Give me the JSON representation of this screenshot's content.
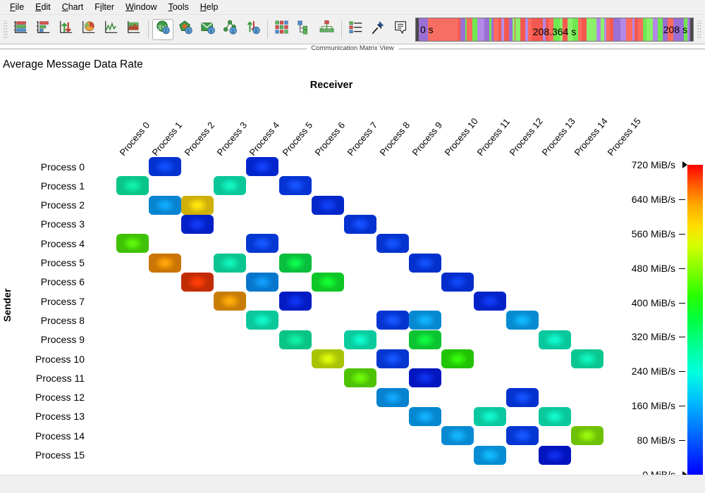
{
  "menubar": {
    "items": [
      {
        "label": "File",
        "accel": "F"
      },
      {
        "label": "Edit",
        "accel": "E"
      },
      {
        "label": "Chart",
        "accel": "C"
      },
      {
        "label": "Filter",
        "accel": "i"
      },
      {
        "label": "Window",
        "accel": "W"
      },
      {
        "label": "Tools",
        "accel": "T"
      },
      {
        "label": "Help",
        "accel": "H"
      }
    ]
  },
  "toolbar": {
    "groups": [
      {
        "buttons": [
          {
            "icon": "bar-chart-horizontal-icon",
            "label": "Bar Chart",
            "selected": false
          },
          {
            "icon": "stacked-chart-icon",
            "label": "Stacked Chart",
            "selected": false
          },
          {
            "icon": "up-down-arrows-icon",
            "label": "Compare Values",
            "selected": false
          },
          {
            "icon": "pie-chart-icon",
            "label": "Pie Chart",
            "selected": false
          },
          {
            "icon": "line-chart-icon",
            "label": "Line Chart",
            "selected": false
          },
          {
            "icon": "area-chart-icon",
            "label": "Area Chart",
            "selected": false
          }
        ]
      },
      {
        "buttons": [
          {
            "icon": "function-sigma-icon",
            "label": "Function Profile",
            "selected": true
          },
          {
            "icon": "pentagon-sigma-icon",
            "label": "Process Profile",
            "selected": false
          },
          {
            "icon": "message-envelope-icon",
            "label": "Message Profile",
            "selected": false
          },
          {
            "icon": "collective-sigma-icon",
            "label": "Collective Operations Profile",
            "selected": false
          },
          {
            "icon": "io-arrows-sigma-icon",
            "label": "I/O Profile",
            "selected": false
          }
        ]
      },
      {
        "buttons": [
          {
            "icon": "matrix-grid-icon",
            "label": "Communication Matrix",
            "selected": false
          },
          {
            "icon": "tree-hierarchy-icon",
            "label": "Call Tree",
            "selected": false
          },
          {
            "icon": "org-tree-icon",
            "label": "Process Tree",
            "selected": false
          }
        ]
      },
      {
        "buttons": [
          {
            "icon": "legend-list-icon",
            "label": "Legend",
            "selected": false
          },
          {
            "icon": "pin-icon",
            "label": "Pin View",
            "selected": false
          },
          {
            "icon": "note-icon",
            "label": "Notes",
            "selected": false
          }
        ]
      }
    ]
  },
  "timeline": {
    "start_label": "0 s",
    "center_label": "208.364 s",
    "end_label": "208 s"
  },
  "view_separator": {
    "caption": "Communication Matrix View"
  },
  "chart": {
    "title": "Average Message Data Rate",
    "column_axis_title": "Receiver",
    "row_axis_title": "Sender"
  },
  "chart_data": {
    "type": "heatmap",
    "title": "Average Message Data Rate",
    "xlabel": "Receiver",
    "ylabel": "Sender",
    "unit": "MiB/s",
    "categories_x": [
      "Process 0",
      "Process 1",
      "Process 2",
      "Process 3",
      "Process 4",
      "Process 5",
      "Process 6",
      "Process 7",
      "Process 8",
      "Process 9",
      "Process 10",
      "Process 11",
      "Process 12",
      "Process 13",
      "Process 14",
      "Process 15"
    ],
    "categories_y": [
      "Process 0",
      "Process 1",
      "Process 2",
      "Process 3",
      "Process 4",
      "Process 5",
      "Process 6",
      "Process 7",
      "Process 8",
      "Process 9",
      "Process 10",
      "Process 11",
      "Process 12",
      "Process 13",
      "Process 14",
      "Process 15"
    ],
    "colorbar": {
      "min": 0,
      "max": 720,
      "ticks": [
        720,
        640,
        560,
        480,
        400,
        320,
        240,
        160,
        80,
        0
      ],
      "tick_labels": [
        "720 MiB/s",
        "640 MiB/s",
        "560 MiB/s",
        "480 MiB/s",
        "400 MiB/s",
        "320 MiB/s",
        "240 MiB/s",
        "160 MiB/s",
        "80 MiB/s",
        "0 MiB/s"
      ],
      "position": "right"
    },
    "cells": [
      {
        "row": 0,
        "col": 1,
        "value": 150,
        "color": "#0432d0",
        "glow": "#1050ff"
      },
      {
        "row": 0,
        "col": 4,
        "value": 145,
        "color": "#0325cd",
        "glow": "#1040fa"
      },
      {
        "row": 1,
        "col": 0,
        "value": 275,
        "color": "#0ac58a",
        "glow": "#10f0a8"
      },
      {
        "row": 1,
        "col": 3,
        "value": 278,
        "color": "#0ac79a",
        "glow": "#11f5c2"
      },
      {
        "row": 1,
        "col": 5,
        "value": 152,
        "color": "#0634d4",
        "glow": "#1553ff"
      },
      {
        "row": 2,
        "col": 1,
        "value": 185,
        "color": "#0684cf",
        "glow": "#11a9fb"
      },
      {
        "row": 2,
        "col": 2,
        "value": 560,
        "color": "#cfb009",
        "glow": "#ffe40b"
      },
      {
        "row": 2,
        "col": 6,
        "value": 148,
        "color": "#0427c9",
        "glow": "#1040f7"
      },
      {
        "row": 3,
        "col": 2,
        "value": 142,
        "color": "#0320c6",
        "glow": "#1039f5"
      },
      {
        "row": 3,
        "col": 7,
        "value": 150,
        "color": "#0531d0",
        "glow": "#1450ff"
      },
      {
        "row": 4,
        "col": 0,
        "value": 392,
        "color": "#3fc105",
        "glow": "#5bf60a"
      },
      {
        "row": 4,
        "col": 4,
        "value": 152,
        "color": "#0537d2",
        "glow": "#1657ff"
      },
      {
        "row": 4,
        "col": 8,
        "value": 150,
        "color": "#0433cf",
        "glow": "#1253fe"
      },
      {
        "row": 5,
        "col": 1,
        "value": 610,
        "color": "#cb7504",
        "glow": "#ffa30a"
      },
      {
        "row": 5,
        "col": 3,
        "value": 272,
        "color": "#0ac590",
        "glow": "#10f2b8"
      },
      {
        "row": 5,
        "col": 5,
        "value": 355,
        "color": "#09bf3d",
        "glow": "#0dfa4e"
      },
      {
        "row": 5,
        "col": 9,
        "value": 148,
        "color": "#0430cd",
        "glow": "#1150fc"
      },
      {
        "row": 6,
        "col": 2,
        "value": 680,
        "color": "#c22c04",
        "glow": "#ff3d06"
      },
      {
        "row": 6,
        "col": 4,
        "value": 180,
        "color": "#0677cc",
        "glow": "#119cfa"
      },
      {
        "row": 6,
        "col": 6,
        "value": 368,
        "color": "#0ec727",
        "glow": "#13fc30"
      },
      {
        "row": 6,
        "col": 10,
        "value": 145,
        "color": "#032ccb",
        "glow": "#1048f9"
      },
      {
        "row": 7,
        "col": 3,
        "value": 608,
        "color": "#c97d04",
        "glow": "#ffab09"
      },
      {
        "row": 7,
        "col": 5,
        "value": 140,
        "color": "#021cc3",
        "glow": "#0f35f2"
      },
      {
        "row": 7,
        "col": 11,
        "value": 142,
        "color": "#0322c7",
        "glow": "#103bf6"
      },
      {
        "row": 8,
        "col": 4,
        "value": 280,
        "color": "#0ac79c",
        "glow": "#11f6c8"
      },
      {
        "row": 8,
        "col": 8,
        "value": 152,
        "color": "#0535d1",
        "glow": "#1555ff"
      },
      {
        "row": 8,
        "col": 9,
        "value": 188,
        "color": "#0689d1",
        "glow": "#11b2fc"
      },
      {
        "row": 8,
        "col": 12,
        "value": 190,
        "color": "#078cd2",
        "glow": "#12b6fc"
      },
      {
        "row": 9,
        "col": 5,
        "value": 268,
        "color": "#0ac486",
        "glow": "#10f0a2"
      },
      {
        "row": 9,
        "col": 7,
        "value": 290,
        "color": "#09cb9e",
        "glow": "#0ffad0"
      },
      {
        "row": 9,
        "col": 9,
        "value": 362,
        "color": "#0cc432",
        "glow": "#11fa40"
      },
      {
        "row": 9,
        "col": 13,
        "value": 282,
        "color": "#0ac89e",
        "glow": "#11f7cc"
      },
      {
        "row": 10,
        "col": 6,
        "value": 500,
        "color": "#a9c406",
        "glow": "#ddf90a"
      },
      {
        "row": 10,
        "col": 8,
        "value": 152,
        "color": "#0536d1",
        "glow": "#1556ff"
      },
      {
        "row": 10,
        "col": 10,
        "value": 382,
        "color": "#22c305",
        "glow": "#33f90a"
      },
      {
        "row": 10,
        "col": 14,
        "value": 275,
        "color": "#0ac792",
        "glow": "#10f4be"
      },
      {
        "row": 11,
        "col": 7,
        "value": 398,
        "color": "#4ec205",
        "glow": "#6ff80a"
      },
      {
        "row": 11,
        "col": 9,
        "value": 138,
        "color": "#0217c0",
        "glow": "#0e30ef"
      },
      {
        "row": 12,
        "col": 8,
        "value": 185,
        "color": "#0682ce",
        "glow": "#11a7fb"
      },
      {
        "row": 12,
        "col": 12,
        "value": 150,
        "color": "#0432ce",
        "glow": "#1251fd"
      },
      {
        "row": 13,
        "col": 9,
        "value": 188,
        "color": "#0688d1",
        "glow": "#11b0fc"
      },
      {
        "row": 13,
        "col": 11,
        "value": 282,
        "color": "#0ac89f",
        "glow": "#11f7ce"
      },
      {
        "row": 13,
        "col": 13,
        "value": 280,
        "color": "#0ac89c",
        "glow": "#11f6ca"
      },
      {
        "row": 14,
        "col": 10,
        "value": 190,
        "color": "#078ad2",
        "glow": "#12b4fc"
      },
      {
        "row": 14,
        "col": 12,
        "value": 152,
        "color": "#0536d2",
        "glow": "#1557ff"
      },
      {
        "row": 14,
        "col": 14,
        "value": 420,
        "color": "#6ec105",
        "glow": "#97f70a"
      },
      {
        "row": 15,
        "col": 11,
        "value": 192,
        "color": "#078dd3",
        "glow": "#12b8fd"
      },
      {
        "row": 15,
        "col": 13,
        "value": 136,
        "color": "#0214be",
        "glow": "#0e2dee"
      }
    ]
  }
}
